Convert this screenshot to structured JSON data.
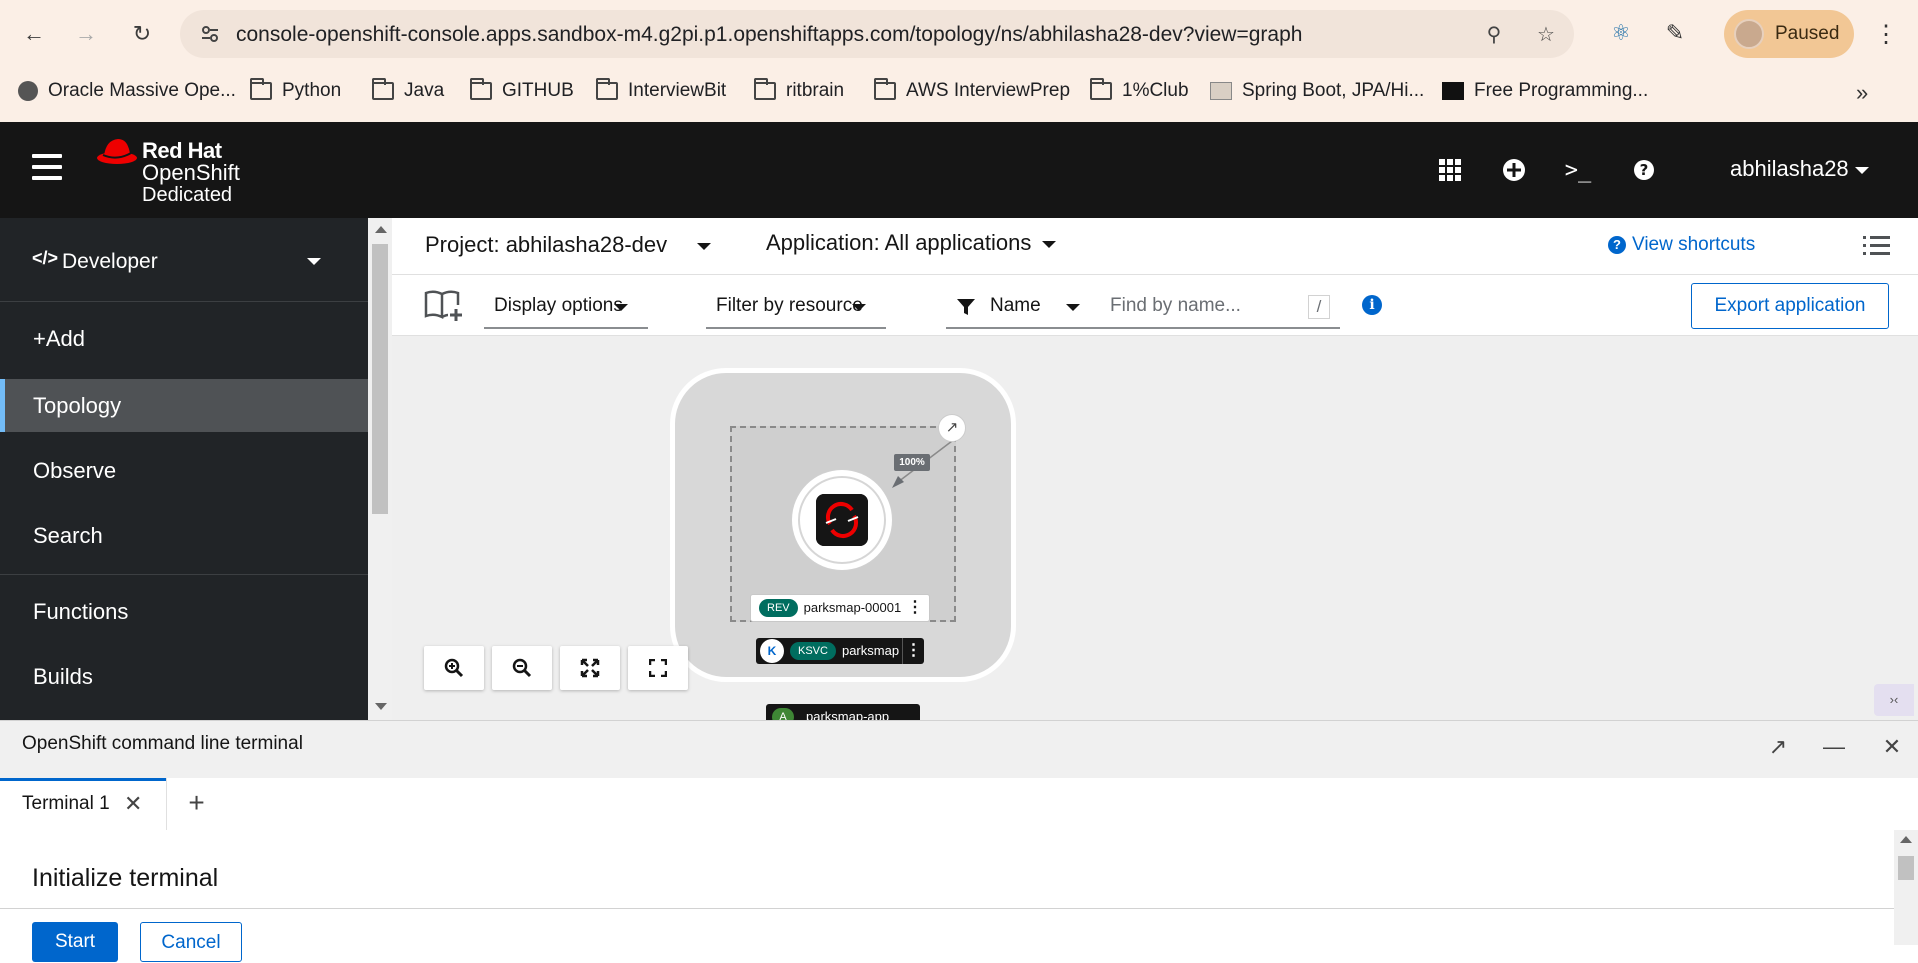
{
  "browser": {
    "url": "console-openshift-console.apps.sandbox-m4.g2pi.p1.openshiftapps.com/topology/ns/abhilasha28-dev?view=graph",
    "profile_label": "Paused",
    "bookmarks": [
      {
        "label": "Oracle Massive Ope...",
        "icon": "globe-icon"
      },
      {
        "label": "Python",
        "icon": "folder-icon"
      },
      {
        "label": "Java",
        "icon": "folder-icon"
      },
      {
        "label": "GITHUB",
        "icon": "folder-icon"
      },
      {
        "label": "InterviewBit",
        "icon": "folder-icon"
      },
      {
        "label": "ritbrain",
        "icon": "folder-icon"
      },
      {
        "label": "AWS InterviewPrep",
        "icon": "folder-icon"
      },
      {
        "label": "1%Club",
        "icon": "folder-icon"
      },
      {
        "label": "Spring Boot, JPA/Hi...",
        "icon": "site-icon"
      },
      {
        "label": "Free Programming...",
        "icon": "site-icon"
      }
    ]
  },
  "masthead": {
    "brand_line1": "Red Hat",
    "brand_line2": "OpenShift",
    "brand_line3": "Dedicated",
    "user": "abhilasha28"
  },
  "sidebar": {
    "perspective": "Developer",
    "items": [
      {
        "label": "+Add"
      },
      {
        "label": "Topology"
      },
      {
        "label": "Observe"
      },
      {
        "label": "Search"
      },
      {
        "label": "Functions"
      },
      {
        "label": "Builds"
      }
    ]
  },
  "header": {
    "project_label": "Project: abhilasha28-dev",
    "application_label": "Application: All applications",
    "shortcuts_label": "View shortcuts"
  },
  "toolbar": {
    "display_options": "Display options",
    "filter_by_resource": "Filter by resource",
    "filter_type": "Name",
    "find_placeholder": "Find by name...",
    "find_shortcut": "/",
    "export_label": "Export application"
  },
  "topology": {
    "traffic_percent": "100%",
    "revision_badge": "REV",
    "revision_name": "parksmap-00001",
    "service_badge": "KSVC",
    "service_name": "parksmap",
    "app_badge": "A",
    "app_name": "parksmap-app"
  },
  "terminal": {
    "title": "OpenShift command line terminal",
    "tab_label": "Terminal 1",
    "heading": "Initialize terminal",
    "start_label": "Start",
    "cancel_label": "Cancel"
  },
  "colors": {
    "accent": "#0066cc",
    "masthead_bg": "#151515",
    "sidebar_bg": "#212427",
    "brand_red": "#ee0000",
    "badge_teal": "#006d5f"
  }
}
